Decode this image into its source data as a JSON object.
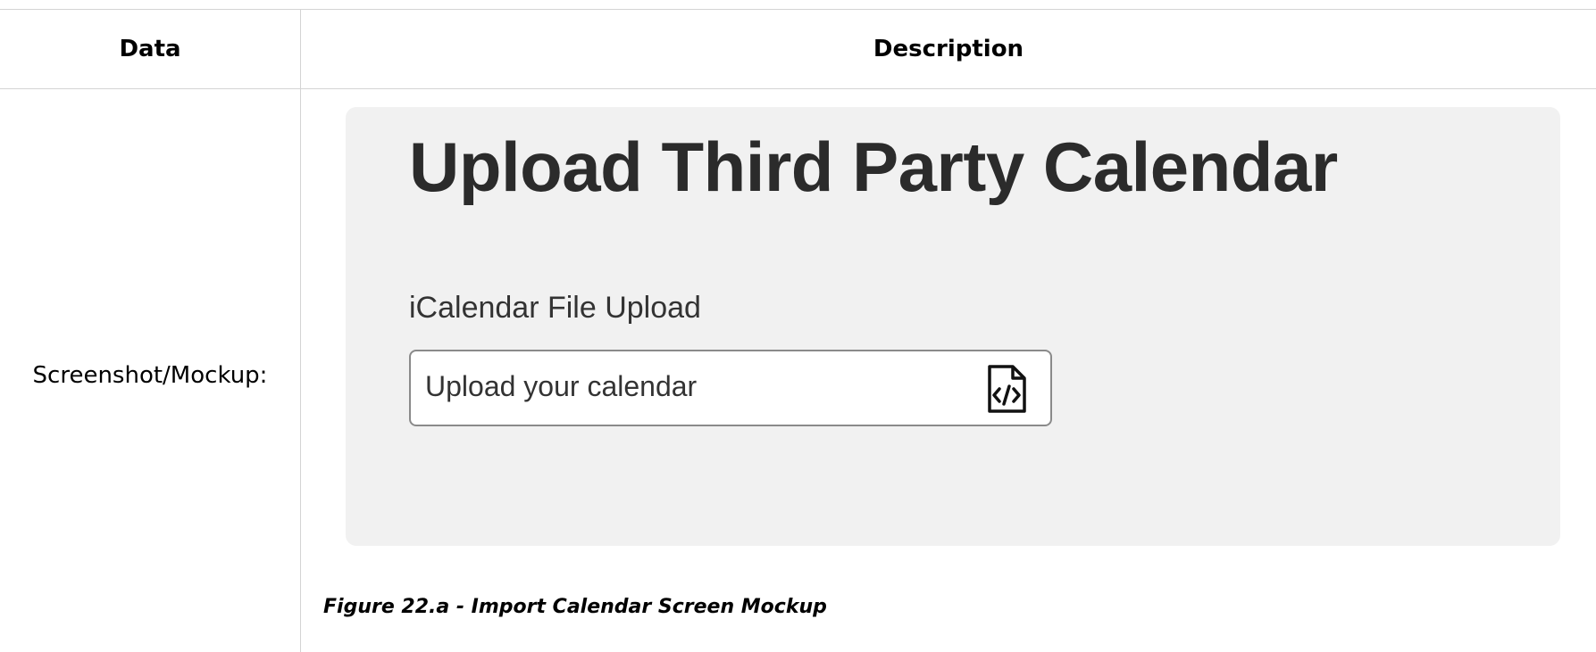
{
  "table": {
    "header_data": "Data",
    "header_description": "Description",
    "row_label": "Screenshot/Mockup:"
  },
  "mockup": {
    "title": "Upload Third Party Calendar",
    "field_label": "iCalendar File Upload",
    "upload_placeholder": "Upload your calendar",
    "upload_icon": "file-code-icon",
    "panel_color": "#f1f1f1"
  },
  "caption": "Figure 22.a - Import Calendar Screen Mockup"
}
